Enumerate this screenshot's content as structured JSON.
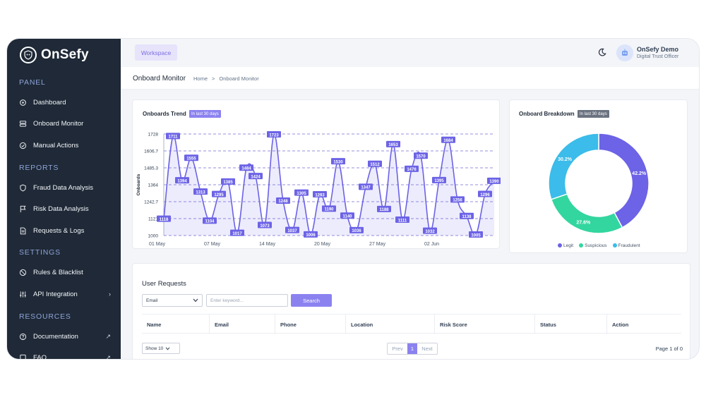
{
  "app": {
    "name": "OnSefy"
  },
  "sidebar": {
    "sections": [
      {
        "label": "PANEL",
        "items": [
          {
            "label": "Dashboard",
            "icon": "dashboard-icon"
          },
          {
            "label": "Onboard Monitor",
            "icon": "server-icon"
          },
          {
            "label": "Manual Actions",
            "icon": "check-circle-icon"
          }
        ]
      },
      {
        "label": "REPORTS",
        "items": [
          {
            "label": "Fraud Data Analysis",
            "icon": "shield-icon"
          },
          {
            "label": "Risk Data Analysis",
            "icon": "flag-icon"
          },
          {
            "label": "Requests & Logs",
            "icon": "file-icon"
          }
        ]
      },
      {
        "label": "SETTINGS",
        "items": [
          {
            "label": "Rules & Blacklist",
            "icon": "ban-icon"
          },
          {
            "label": "API Integration",
            "icon": "sliders-icon",
            "arrow": "›"
          }
        ]
      },
      {
        "label": "RESOURCES",
        "items": [
          {
            "label": "Documentation",
            "icon": "help-icon",
            "arrow": "↗"
          },
          {
            "label": "FAQ",
            "icon": "faq-icon",
            "arrow": "↗"
          }
        ]
      }
    ]
  },
  "topbar": {
    "workspace_label": "Workspace",
    "user_name": "OnSefy Demo",
    "user_role": "Digital Trust Officer"
  },
  "page": {
    "title": "Onboard Monitor",
    "breadcrumb": [
      "Home",
      ">",
      "Onboard Monitor"
    ]
  },
  "trend_card": {
    "title": "Onboards Trend",
    "badge": "In last 30 days",
    "badge_color": "#8b82f0"
  },
  "breakdown_card": {
    "title": "Onboard Breakdown",
    "badge": "In last 30 days",
    "badge_color": "#6b7280"
  },
  "chart_data": [
    {
      "type": "line",
      "ylabel": "Onboards",
      "yticks": [
        "1000",
        "1121",
        "1242.7",
        "1364",
        "1485.3",
        "1606.7",
        "1728"
      ],
      "ytick_values": [
        1000,
        1121.3,
        1242.7,
        1364,
        1485.3,
        1606.7,
        1728
      ],
      "xticks": [
        "01 May",
        "07 May",
        "14 May",
        "20 May",
        "27 May",
        "02 Jun"
      ],
      "xtick_index": [
        0,
        6,
        12,
        18,
        24,
        30
      ],
      "ylim": [
        1000,
        1728
      ],
      "values": [
        1118,
        1711,
        1394,
        1555,
        1313,
        1104,
        1295,
        1385,
        1017,
        1484,
        1424,
        1073,
        1723,
        1248,
        1037,
        1305,
        1006,
        1293,
        1190,
        1530,
        1140,
        1036,
        1347,
        1512,
        1188,
        1653,
        1111,
        1476,
        1570,
        1032,
        1395,
        1684,
        1256,
        1138,
        1005,
        1296,
        1390
      ],
      "color": "#6c63e6"
    },
    {
      "type": "pie",
      "series": [
        {
          "name": "Legit",
          "value": 42.2,
          "color": "#6c63e6"
        },
        {
          "name": "Suspicious",
          "value": 27.6,
          "color": "#33d69f"
        },
        {
          "name": "Fraudulent",
          "value": 30.2,
          "color": "#3bbcea"
        }
      ],
      "labels": [
        "42.2%",
        "27.6%",
        "30.2%"
      ]
    }
  ],
  "requests": {
    "title": "User Requests",
    "filter_value": "Email",
    "search_placeholder": "Enter keyword...",
    "search_label": "Search",
    "columns": [
      "Name",
      "Email",
      "Phone",
      "Location",
      "Risk Score",
      "Status",
      "Action"
    ],
    "page_size": "Show 10",
    "pager": {
      "prev": "Prev",
      "current": "1",
      "next": "Next"
    },
    "page_of": "Page 1 of 0"
  }
}
